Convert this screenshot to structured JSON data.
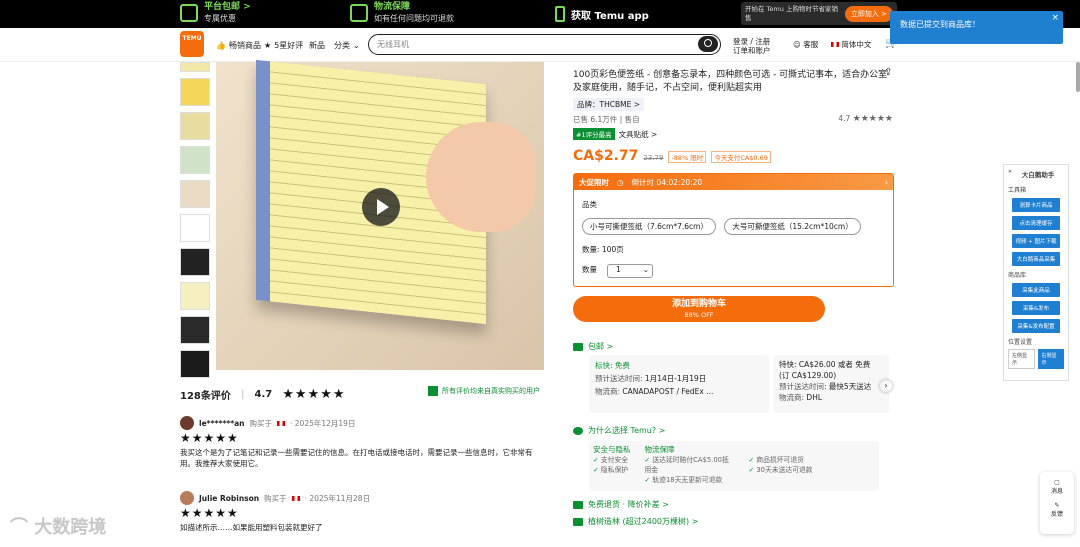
{
  "topbar": {
    "item1_title": "平台包邮 >",
    "item1_sub": "专属优惠",
    "item2_title": "物流保障",
    "item2_sub": "如有任何问题均可退款",
    "app_label": "获取 Temu app",
    "promo_text": "开始在 Temu 上购物时节省家销售",
    "promo_button": "立即加入 >"
  },
  "header": {
    "logo_text": "TEMU",
    "nav": [
      "畅销商品",
      "5星好评",
      "新品",
      "分类"
    ],
    "search_placeholder": "无线耳机",
    "login": "登录 / 注册",
    "orders": "订单和账户",
    "support": "客服",
    "language": "简体中文"
  },
  "gallery": {
    "thumb_count": 10
  },
  "reviews": {
    "count_label": "128条评价",
    "rating": "4.7",
    "stars": "★★★★★",
    "verified_note": "所有评价均来自真实购买的用户",
    "items": [
      {
        "user": "le*******an",
        "meta": "购买于",
        "date": "· 2025年12月19日",
        "stars": "★★★★★",
        "text": "我买这个是为了记笔记和记录一些需要记住的信息。在打电话或接电话时，需要记录一些信息时，它非常有用。我推荐大家使用它。"
      },
      {
        "user": "Julie Robinson",
        "meta": "购买于",
        "date": "· 2025年11月28日",
        "stars": "★★★★★",
        "text": "如描述所示……如果能用塑料包装就更好了"
      }
    ]
  },
  "product": {
    "title": "100页彩色便签纸 - 创意备忘录本，四种颜色可选 - 可撕式记事本，适合办公室及家庭使用，随手记，不占空间，便利贴超实用",
    "brand": "品牌：THCBME >",
    "sold": "已售 6.1万件 | 售自",
    "rating": "4.7",
    "rating_stars": "★★★★★",
    "rank_tag": "#1评分最高",
    "rank_category": "文具贴纸 >",
    "price": "CA$2.77",
    "old_price": "23.79",
    "discount": "-88% 限时",
    "extra_tag": "今天支付CA$0.69",
    "deal_label": "大促限时",
    "deal_timer": "倒计时 04:02:20:20",
    "variant_label": "品类",
    "variants": [
      "小号可撕便签纸（7.6cm*7.6cm）",
      "大号可撕便签纸（15.2cm*10cm）"
    ],
    "count_label": "数量: 100页",
    "qty_label": "数量",
    "qty_value": "1",
    "cart_button": "添加到购物车",
    "cart_sub": "88% OFF"
  },
  "shipping": {
    "heading": "包邮 >",
    "box1": {
      "title": "标快: 免费",
      "eta_label": "预计送达时间:",
      "eta": "1月14日-1月19日",
      "carrier_label": "物流商:",
      "carrier": "CANADAPOST / FedEx ..."
    },
    "box2": {
      "title": "特快: CA$26.00 或者 免费 (订 CA$129.00)",
      "eta_label": "预计送达时间:",
      "eta": "最快5天送达",
      "carrier_label": "物流商:",
      "carrier": "DHL"
    }
  },
  "why": {
    "heading": "为什么选择 Temu? >",
    "col1_title": "安全与隐私",
    "col1_items": [
      "支付安全",
      "隐私保护"
    ],
    "col2_title": "物流保障",
    "col2_items": [
      "送达延时赔付CA$5.00抵用金",
      "轨迹18天无更新可退款"
    ],
    "col3_items": [
      "商品损坏可退货",
      "30天未送达可退款"
    ]
  },
  "free_return": "免费退货 · 降价补差 >",
  "green": "植树造林 (超过2400万棵树) >",
  "toast": "数据已提交到商品库！",
  "plugin": {
    "title": "大白鹅助手",
    "tools_label": "工具箱",
    "buttons": [
      "测算卡片商品",
      "点击清理缓存",
      "视频 + 图片下载",
      "大白鹅商品采集"
    ],
    "library_label": "商品库",
    "library_buttons": [
      "采集此商品",
      "采集&发布",
      "采集&发布配置"
    ],
    "position_label": "位置设置",
    "left": "左侧显示",
    "right": "右侧显示"
  },
  "fab": [
    "消息",
    "反馈"
  ],
  "watermark": "大数跨境"
}
